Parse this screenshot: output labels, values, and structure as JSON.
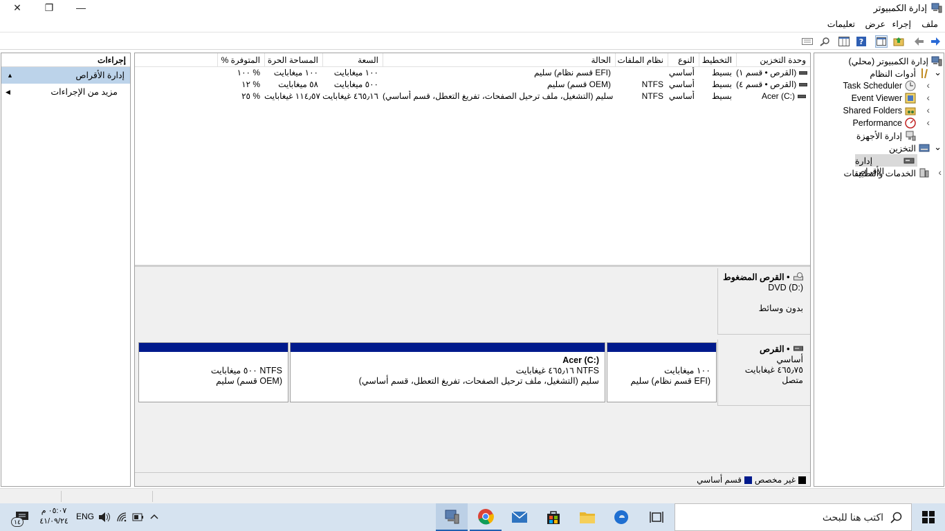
{
  "window": {
    "title": "إدارة الكمبيوتر",
    "close_glyph": "✕",
    "restore_glyph": "❐",
    "minimize_glyph": "—"
  },
  "menu": [
    "ملف",
    "إجراء",
    "عرض",
    "تعليمات"
  ],
  "tree": {
    "root": "إدارة الكمبيوتر (محلي)",
    "items": [
      {
        "label": "أدوات النظام",
        "expand": "⌄"
      },
      {
        "label": "Task Scheduler",
        "expand": "‹"
      },
      {
        "label": "Event Viewer",
        "expand": "‹"
      },
      {
        "label": "Shared Folders",
        "expand": "‹"
      },
      {
        "label": "Performance",
        "expand": "‹"
      },
      {
        "label": "إدارة الأجهزة",
        "expand": ""
      },
      {
        "label": "التخزين",
        "expand": "⌄"
      },
      {
        "label": "إدارة الأقراص",
        "expand": ""
      },
      {
        "label": "الخدمات والتطبيقات",
        "expand": "‹"
      }
    ]
  },
  "volumes": {
    "headers": [
      "وحدة التخزين",
      "التخطيط",
      "النوع",
      "نظام الملفات",
      "الحالة",
      "السعة",
      "المساحة الحرة",
      "% المتوفرة"
    ],
    "rows": [
      [
        "(القرص • قسم ١)",
        "بسيط",
        "أساسي",
        "",
        "سليم (قسم نظام EFI)",
        "١٠٠ ميغابايت",
        "١٠٠ ميغابايت",
        "١٠٠ %"
      ],
      [
        "(القرص • قسم ٤)",
        "بسيط",
        "أساسي",
        "NTFS",
        "سليم (قسم OEM)",
        "٥٠٠ ميغابايت",
        "٥٨ ميغابايت",
        "١٢ %"
      ],
      [
        "Acer (C:)",
        "بسيط",
        "أساسي",
        "NTFS",
        "سليم (التشغيل، ملف ترحيل الصفحات، تفريغ التعطل، قسم أساسي)",
        "٤٦٥٫١٦ غيغابايت",
        "١١٤٫٥٧ غيغابايت",
        "٢٥ %"
      ]
    ]
  },
  "cdrom": {
    "title": "القرص المضغوط •",
    "drive": "DVD (D:)",
    "media": "بدون وسائط"
  },
  "disk0": {
    "title": "القرص •",
    "type": "أساسي",
    "size": "٤٦٥٫٧٥ غيغابايت",
    "status": "متصل",
    "partitions": [
      {
        "line1": "١٠٠ ميغابايت",
        "line2": "سليم (قسم نظام EFI)",
        "name": ""
      },
      {
        "name": "Acer  (C:)",
        "line1": "٤٦٥٫١٦ غيغابايت NTFS",
        "line2": "سليم (التشغيل، ملف ترحيل الصفحات، تفريغ التعطل، قسم أساسي)"
      },
      {
        "line1": "٥٠٠ ميغابايت NTFS",
        "line2": "سليم (قسم OEM)",
        "name": ""
      }
    ]
  },
  "legend": [
    {
      "label": "غير مخصص",
      "color": "#000000"
    },
    {
      "label": "قسم أساسي",
      "color": "#001a8c"
    }
  ],
  "actions": {
    "header": "إجراءات",
    "section": "إدارة الأقراص",
    "more": "مزيد من الإجراءات"
  },
  "taskbar": {
    "search_placeholder": "اكتب هنا للبحث",
    "lang": "ENG",
    "time": "٠٥:٠٧ م",
    "date": "٤١/٠٩/٢٤",
    "notif_count": "١٤"
  },
  "colors": {
    "accent": "#001a8c",
    "selection": "#bcd3ea",
    "taskbar": "#d6e3f0"
  }
}
